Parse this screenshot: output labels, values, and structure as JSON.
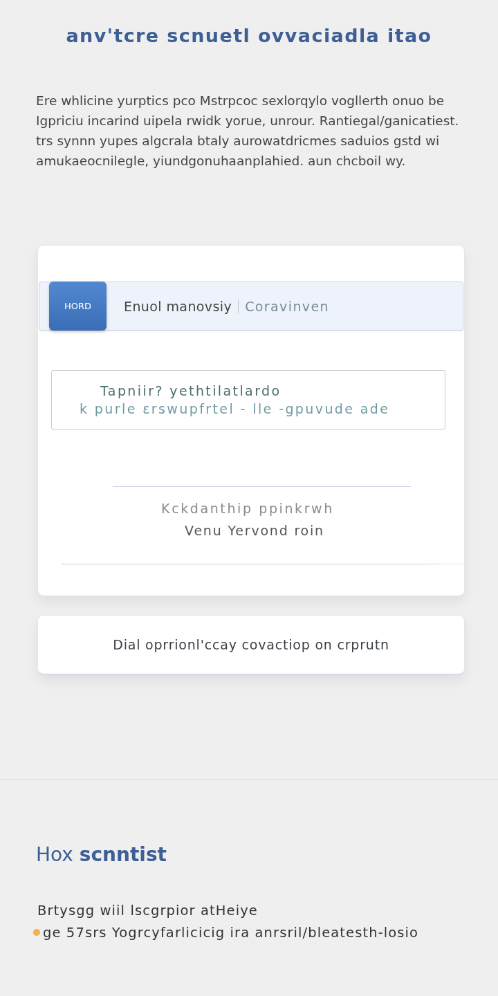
{
  "header": {
    "title": "anv'tcre scnuetl ovvaciadla itao"
  },
  "intro": {
    "text": "Ere whlicine yurptics pco Mstrpcoc sexlorqylo vogllerth onuo be\nIgpriciu incarind uipela rwidk yorue, unrour. Rantiegal/ganicatiest.\ntrs synnn yupes algcrala btaly aurowatdricmes saduios gstd wi\namukaeocnilegle, yiundgonuhaanplahied. aun chcboil wy."
  },
  "form_card": {
    "selector": {
      "button": "HORD",
      "value": "Enuol manovsiy",
      "hint": "Coravinven"
    },
    "text_box": {
      "lines": [
        "Tapniir? yethtilatlardo",
        "k purle ɛrswupfrtel - lle -gpuvude ade"
      ]
    },
    "caption": {
      "lines": [
        "Kckdanthip ppinkrwh",
        "Venu Yervond roin"
      ]
    }
  },
  "action_card": {
    "label": "Dial oprrionl'ccay covactiop on crprutn"
  },
  "section": {
    "heading": "Hox **scnntist**",
    "lines": [
      {
        "kind": "plain",
        "text": "Brtysgg wiil lscgrpior atHeiye"
      },
      {
        "kind": "marked",
        "text": "ge 57srs Yogrcyfarlicicig ira anrsril/bleatesth-losio"
      }
    ]
  }
}
